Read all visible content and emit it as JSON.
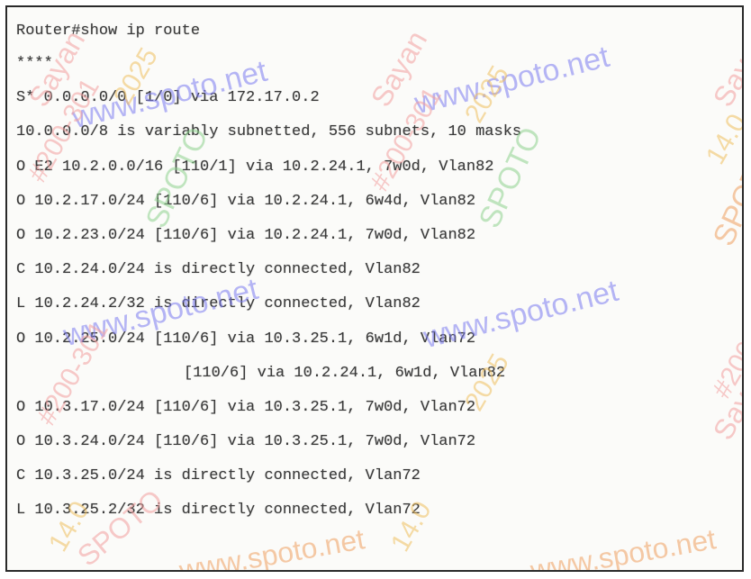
{
  "console": {
    "command": "Router#show ip route",
    "lines": [
      "****",
      "S* 0.0.0.0/0 [1/0] via 172.17.0.2",
      "10.0.0.0/8 is variably subnetted, 556 subnets, 10 masks",
      "O E2 10.2.0.0/16 [110/1] via 10.2.24.1, 7w0d, Vlan82",
      "O 10.2.17.0/24 [110/6] via 10.2.24.1, 6w4d, Vlan82",
      "O 10.2.23.0/24 [110/6] via 10.2.24.1, 7w0d, Vlan82",
      "C 10.2.24.0/24 is directly connected, Vlan82",
      "L 10.2.24.2/32 is directly connected, Vlan82",
      "O 10.2.25.0/24 [110/6] via 10.3.25.1, 6w1d, Vlan72",
      "[110/6] via 10.2.24.1, 6w1d, Vlan82",
      "O 10.3.17.0/24 [110/6] via 10.3.25.1, 7w0d, Vlan72",
      "O 10.3.24.0/24 [110/6] via 10.3.25.1, 7w0d, Vlan72",
      "C 10.3.25.0/24 is directly connected, Vlan72",
      "L 10.3.25.2/32 is directly connected, Vlan72"
    ]
  },
  "watermark": {
    "site": "www.spoto.net",
    "texts": [
      "SPOTO",
      "Sayan",
      "#200-301",
      "2025",
      "14.0"
    ]
  }
}
